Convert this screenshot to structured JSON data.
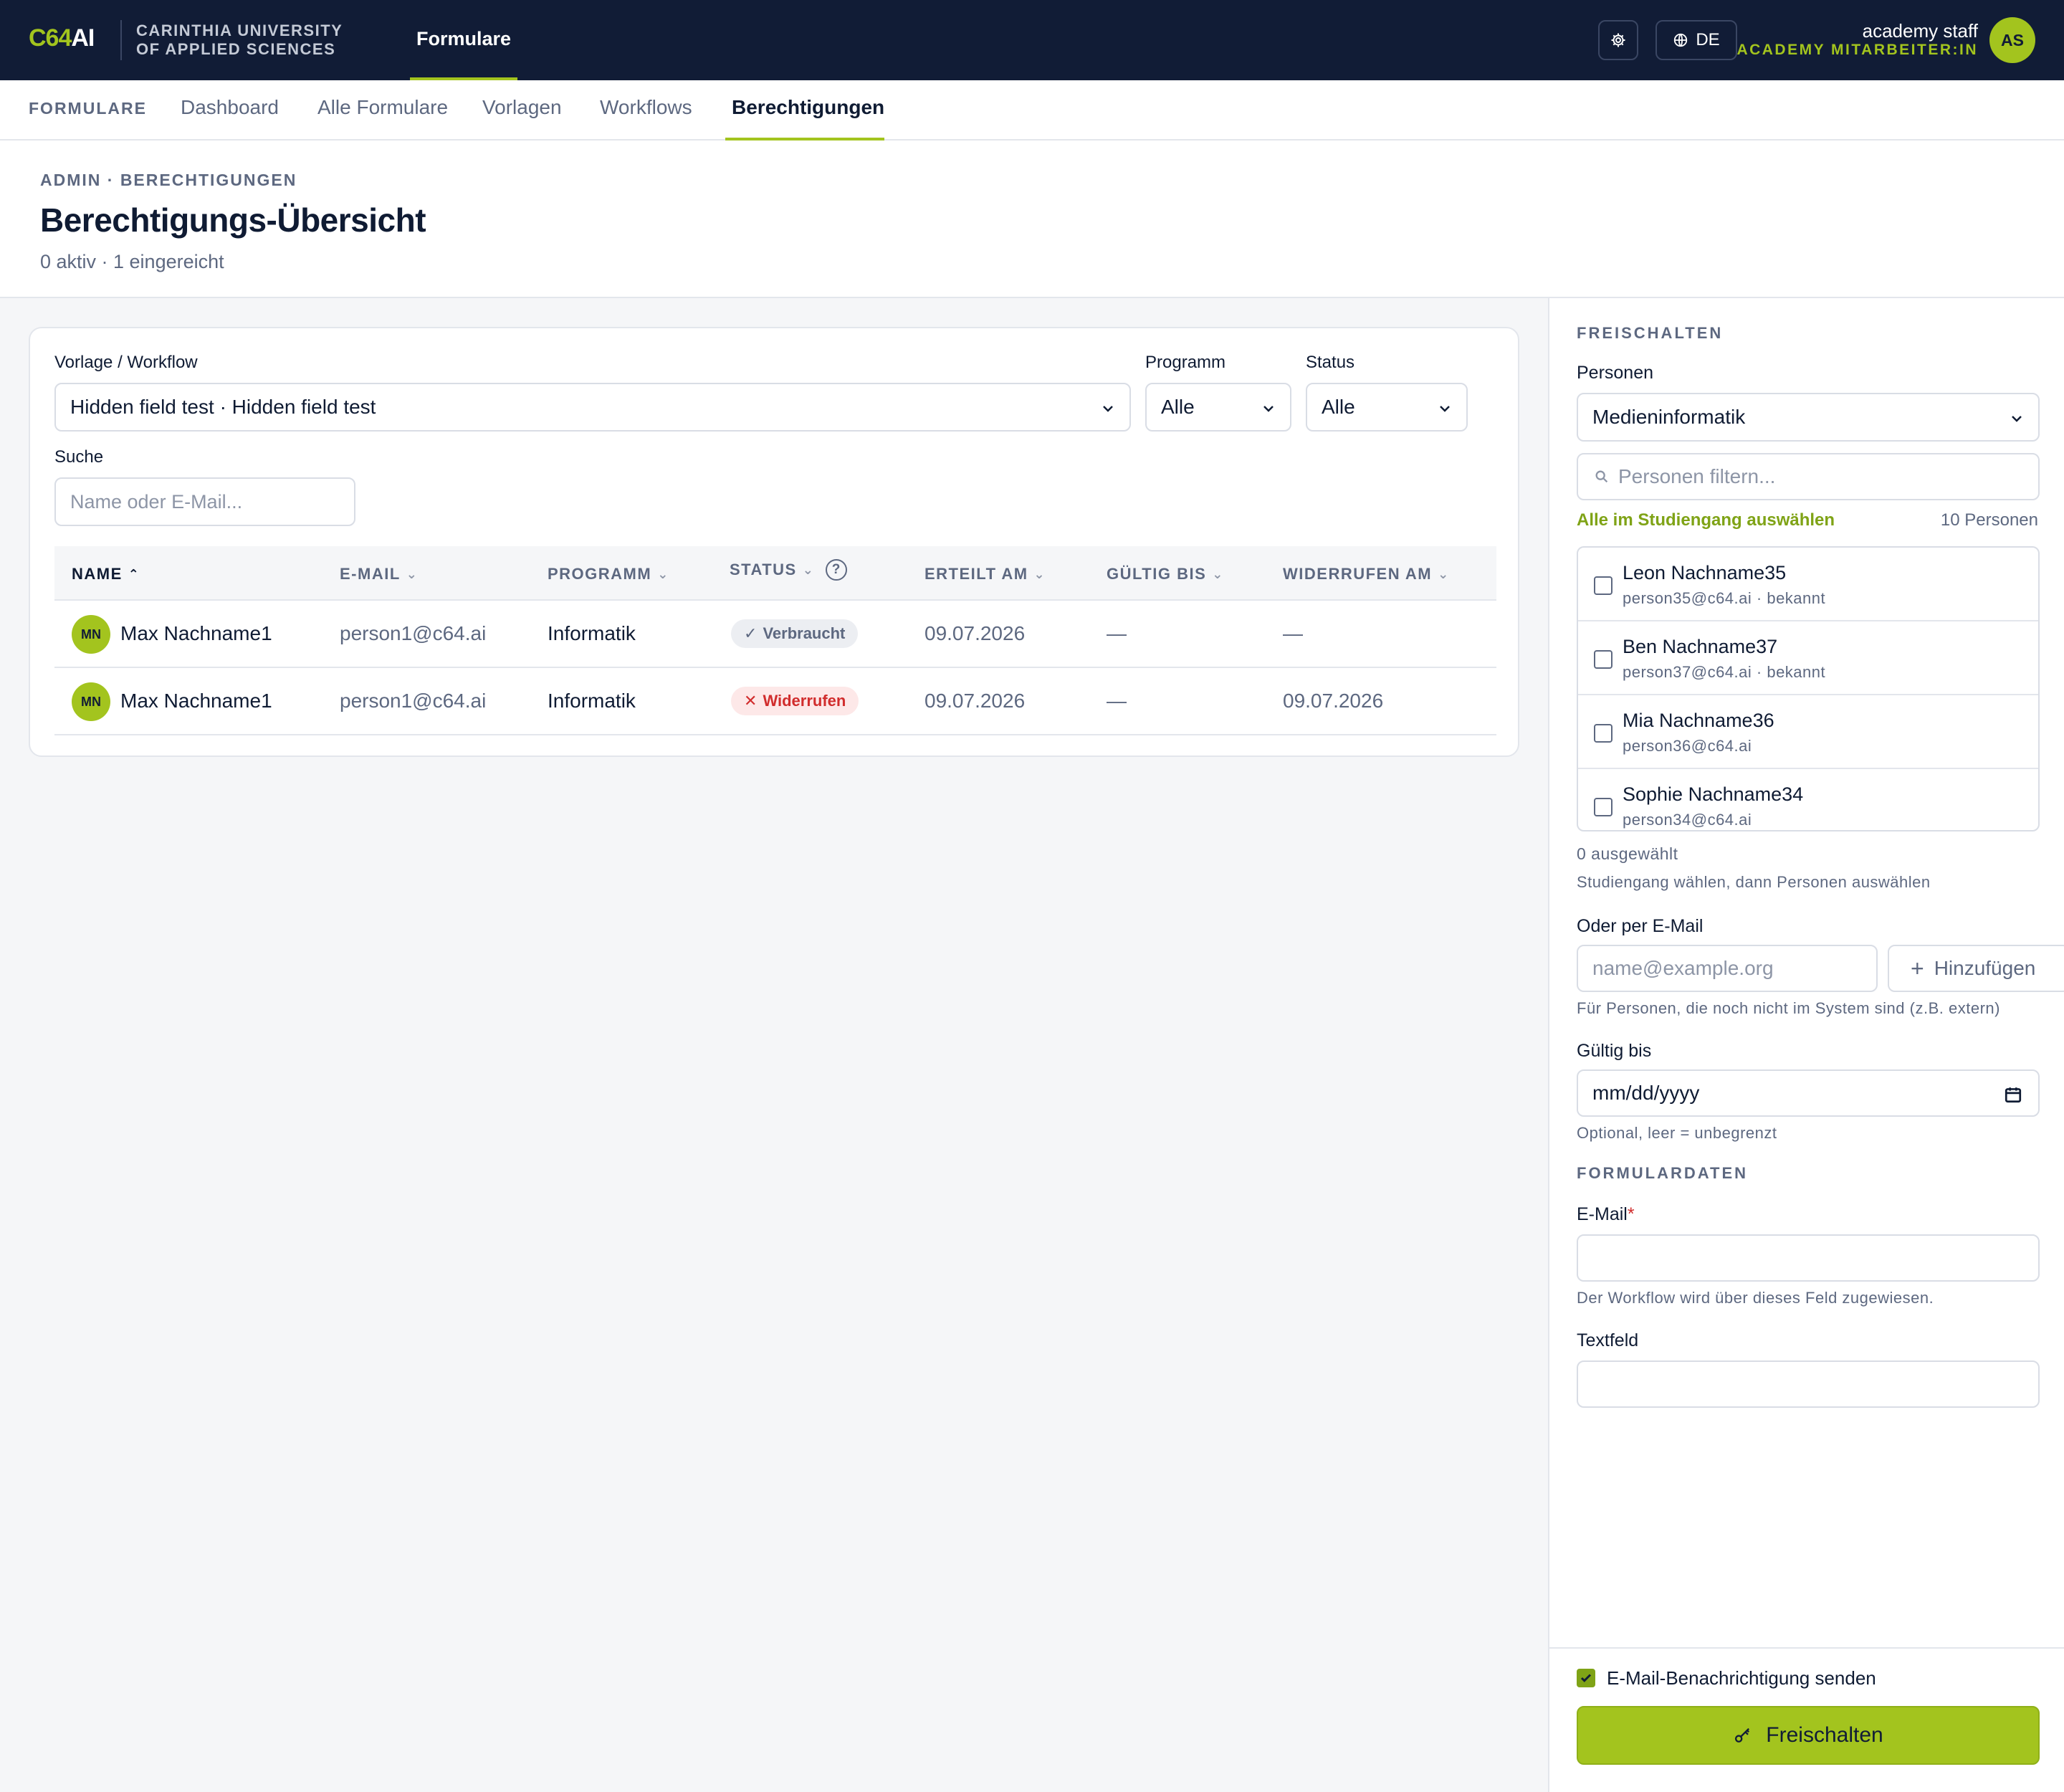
{
  "topbar": {
    "logo_prefix": "C64",
    "logo_suffix": "AI",
    "org_line1": "CARINTHIA UNIVERSITY",
    "org_line2": "OF APPLIED SCIENCES",
    "active_tab": "Formulare",
    "language": "DE",
    "user_name": "academy staff",
    "user_role": "ACADEMY MITARBEITER:IN",
    "user_initials": "AS"
  },
  "subnav": {
    "label": "FORMULARE",
    "items": [
      "Dashboard",
      "Alle Formulare",
      "Vorlagen",
      "Workflows",
      "Berechtigungen"
    ],
    "active": "Berechtigungen"
  },
  "header": {
    "breadcrumb": "ADMIN · BERECHTIGUNGEN",
    "title": "Berechtigungs-Übersicht",
    "subtitle": "0 aktiv · 1 eingereicht"
  },
  "filters": {
    "template_label": "Vorlage / Workflow",
    "template_value": "Hidden field test · Hidden field test",
    "program_label": "Programm",
    "program_value": "Alle",
    "status_label": "Status",
    "status_value": "Alle",
    "search_label": "Suche",
    "search_placeholder": "Name oder E-Mail..."
  },
  "table": {
    "columns": [
      "NAME",
      "E-MAIL",
      "PROGRAMM",
      "STATUS",
      "ERTEILT AM",
      "GÜLTIG BIS",
      "WIDERRUFEN AM"
    ],
    "rows": [
      {
        "initials": "MN",
        "name": "Max Nachname1",
        "email": "person1@c64.ai",
        "program": "Informatik",
        "status": "Verbraucht",
        "granted": "09.07.2026",
        "valid_until": "—",
        "revoked": "—"
      },
      {
        "initials": "MN",
        "name": "Max Nachname1",
        "email": "person1@c64.ai",
        "program": "Informatik",
        "status": "Widerrufen",
        "granted": "09.07.2026",
        "valid_until": "—",
        "revoked": "09.07.2026"
      }
    ]
  },
  "panel": {
    "title": "FREISCHALTEN",
    "persons_label": "Personen",
    "program_select": "Medieninformatik",
    "filter_placeholder": "Personen filtern...",
    "select_all": "Alle im Studiengang auswählen",
    "count": "10 Personen",
    "people": [
      {
        "name": "Leon Nachname35",
        "meta": "person35@c64.ai · bekannt"
      },
      {
        "name": "Ben Nachname37",
        "meta": "person37@c64.ai · bekannt"
      },
      {
        "name": "Mia Nachname36",
        "meta": "person36@c64.ai"
      },
      {
        "name": "Sophie Nachname34",
        "meta": "person34@c64.ai"
      }
    ],
    "selected_count": "0 ausgewählt",
    "selection_hint": "Studiengang wählen, dann Personen auswählen",
    "email_label": "Oder per E-Mail",
    "email_placeholder": "name@example.org",
    "add_button": "Hinzufügen",
    "email_hint": "Für Personen, die noch nicht im System sind (z.B. extern)",
    "valid_label": "Gültig bis",
    "date_placeholder": "mm/dd/yyyy",
    "valid_hint": "Optional, leer = unbegrenzt",
    "formdata_title": "FORMULARDATEN",
    "field_email_label": "E-Mail",
    "field_email_required": "*",
    "field_email_hint": "Der Workflow wird über dieses Feld zugewiesen.",
    "field_text_label": "Textfeld",
    "notify_label": "E-Mail-Benachrichtigung senden",
    "notify_checked": true,
    "submit_label": "Freischalten"
  },
  "colors": {
    "accent": "#a3c41e",
    "navy": "#111c36",
    "danger": "#d12d2d"
  }
}
